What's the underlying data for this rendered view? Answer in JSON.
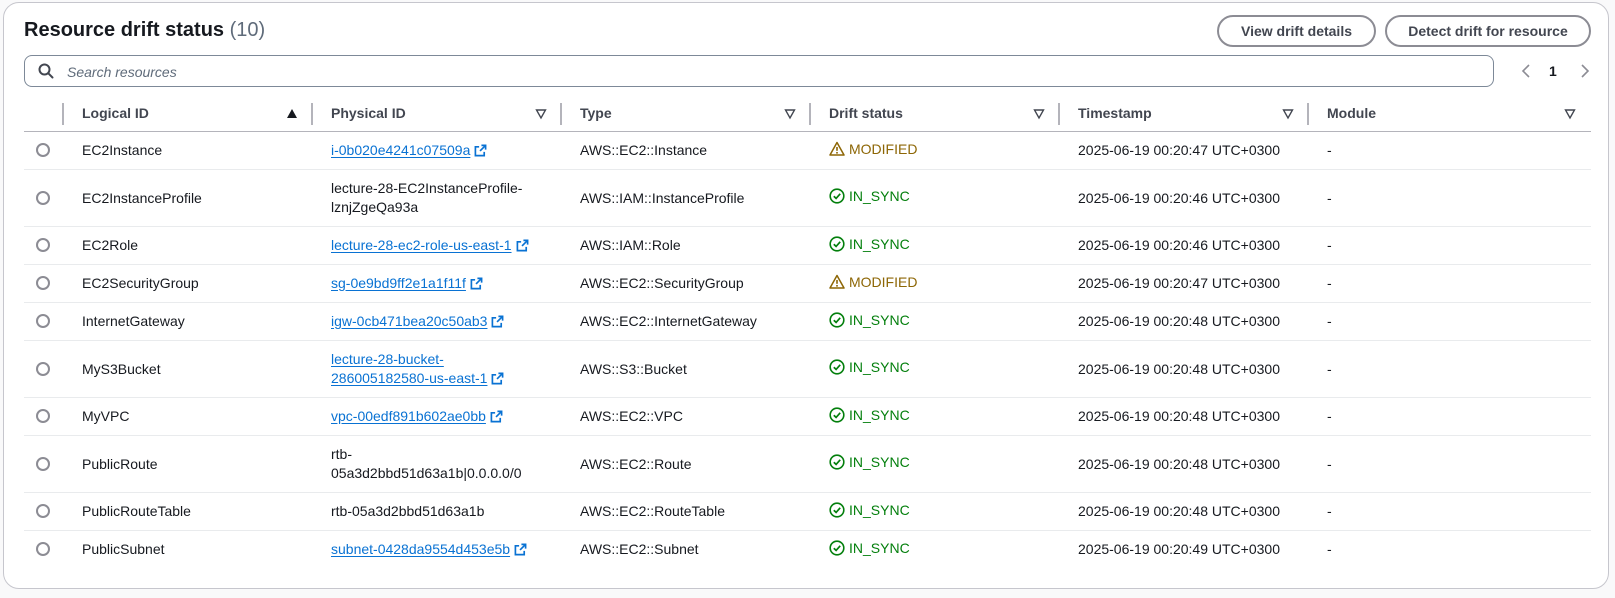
{
  "header": {
    "title": "Resource drift status",
    "count": "(10)"
  },
  "buttons": {
    "view": "View drift details",
    "detect": "Detect drift for resource"
  },
  "search": {
    "placeholder": "Search resources",
    "value": ""
  },
  "pagination": {
    "page": "1"
  },
  "colors": {
    "link": "#0972d3",
    "modified": "#8d6605",
    "in_sync": "#037f0c"
  },
  "columns": {
    "logical_id": "Logical ID",
    "physical_id": "Physical ID",
    "type": "Type",
    "drift_status": "Drift status",
    "timestamp": "Timestamp",
    "module": "Module"
  },
  "rows": [
    {
      "logical_id": "EC2Instance",
      "physical_id": "i-0b020e4241c07509a",
      "physical_link": true,
      "type": "AWS::EC2::Instance",
      "status": "MODIFIED",
      "status_icon": "warning-icon",
      "timestamp": "2025-06-19 00:20:47 UTC+0300",
      "module": "-"
    },
    {
      "logical_id": "EC2InstanceProfile",
      "physical_id_lines": [
        "lecture-28-EC2InstanceProfile-",
        "lznjZgeQa93a"
      ],
      "physical_link": false,
      "type": "AWS::IAM::InstanceProfile",
      "status": "IN_SYNC",
      "status_icon": "check-circle-icon",
      "timestamp": "2025-06-19 00:20:46 UTC+0300",
      "module": "-"
    },
    {
      "logical_id": "EC2Role",
      "physical_id": "lecture-28-ec2-role-us-east-1",
      "physical_link": true,
      "type": "AWS::IAM::Role",
      "status": "IN_SYNC",
      "status_icon": "check-circle-icon",
      "timestamp": "2025-06-19 00:20:46 UTC+0300",
      "module": "-"
    },
    {
      "logical_id": "EC2SecurityGroup",
      "physical_id": "sg-0e9bd9ff2e1a1f11f",
      "physical_link": true,
      "type": "AWS::EC2::SecurityGroup",
      "status": "MODIFIED",
      "status_icon": "warning-icon",
      "timestamp": "2025-06-19 00:20:47 UTC+0300",
      "module": "-"
    },
    {
      "logical_id": "InternetGateway",
      "physical_id": "igw-0cb471bea20c50ab3",
      "physical_link": true,
      "type": "AWS::EC2::InternetGateway",
      "status": "IN_SYNC",
      "status_icon": "check-circle-icon",
      "timestamp": "2025-06-19 00:20:48 UTC+0300",
      "module": "-"
    },
    {
      "logical_id": "MyS3Bucket",
      "physical_id_lines": [
        "lecture-28-bucket-",
        "286005182580-us-east-1"
      ],
      "physical_link": true,
      "type": "AWS::S3::Bucket",
      "status": "IN_SYNC",
      "status_icon": "check-circle-icon",
      "timestamp": "2025-06-19 00:20:48 UTC+0300",
      "module": "-"
    },
    {
      "logical_id": "MyVPC",
      "physical_id": "vpc-00edf891b602ae0bb",
      "physical_link": true,
      "type": "AWS::EC2::VPC",
      "status": "IN_SYNC",
      "status_icon": "check-circle-icon",
      "timestamp": "2025-06-19 00:20:48 UTC+0300",
      "module": "-"
    },
    {
      "logical_id": "PublicRoute",
      "physical_id_lines": [
        "rtb-",
        "05a3d2bbd51d63a1b|0.0.0.0/0"
      ],
      "physical_link": false,
      "type": "AWS::EC2::Route",
      "status": "IN_SYNC",
      "status_icon": "check-circle-icon",
      "timestamp": "2025-06-19 00:20:48 UTC+0300",
      "module": "-"
    },
    {
      "logical_id": "PublicRouteTable",
      "physical_id": "rtb-05a3d2bbd51d63a1b",
      "physical_link": false,
      "type": "AWS::EC2::RouteTable",
      "status": "IN_SYNC",
      "status_icon": "check-circle-icon",
      "timestamp": "2025-06-19 00:20:48 UTC+0300",
      "module": "-"
    },
    {
      "logical_id": "PublicSubnet",
      "physical_id": "subnet-0428da9554d453e5b",
      "physical_link": true,
      "type": "AWS::EC2::Subnet",
      "status": "IN_SYNC",
      "status_icon": "check-circle-icon",
      "timestamp": "2025-06-19 00:20:49 UTC+0300",
      "module": "-"
    }
  ]
}
